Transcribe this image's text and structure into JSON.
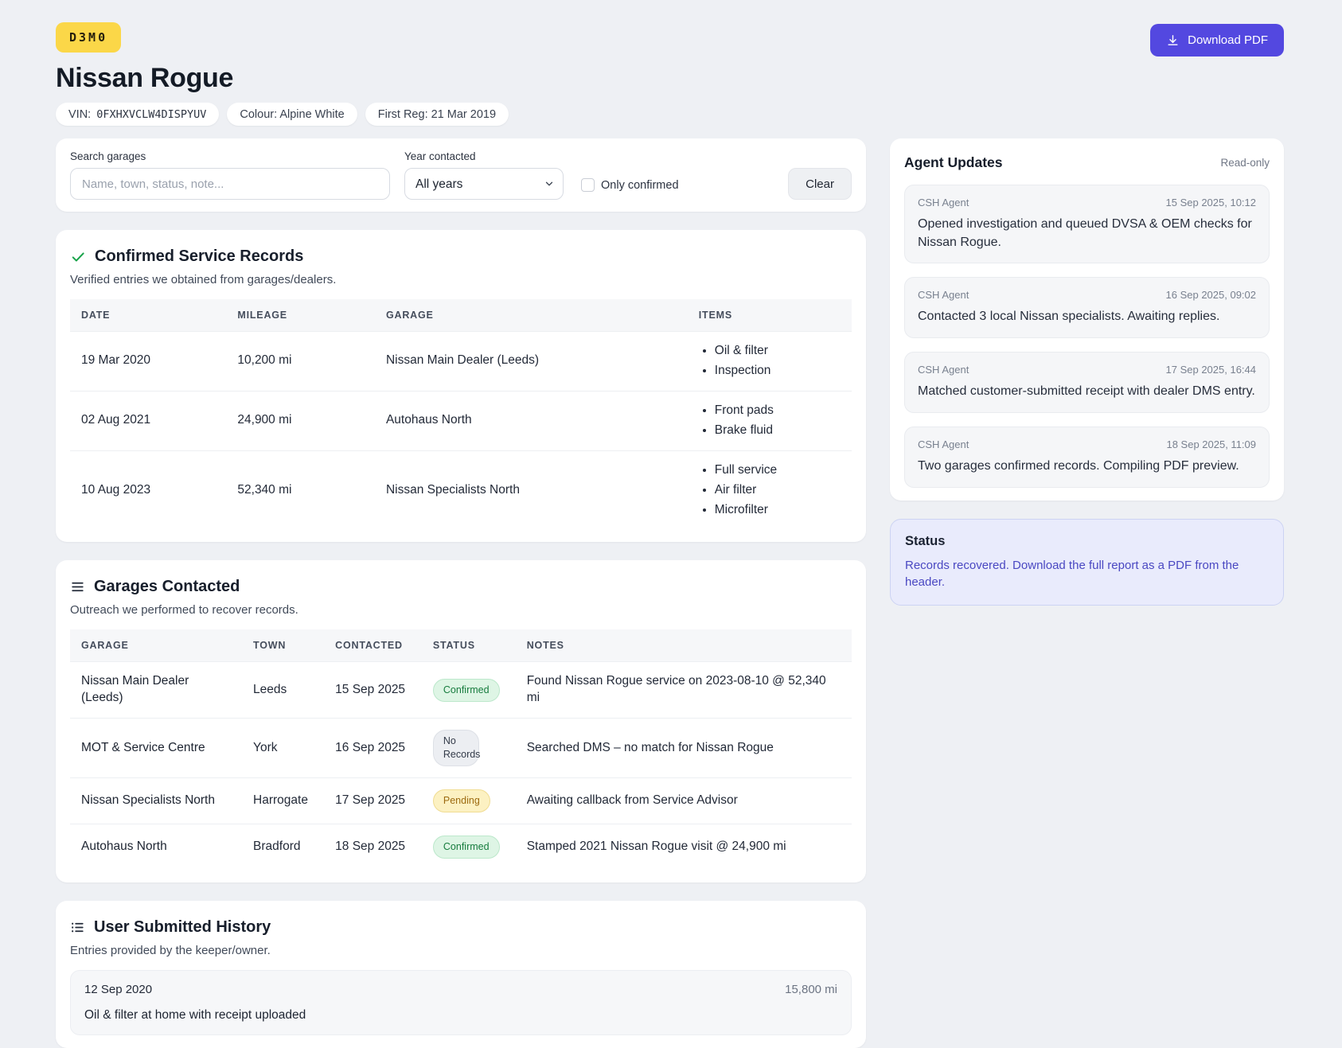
{
  "header": {
    "badge": "D3M0",
    "title": "Nissan Rogue",
    "chips": [
      {
        "label": "VIN:",
        "value": "0FXHXVCLW4DISPYUV",
        "value_mono": true
      },
      {
        "label": "Colour: Alpine White"
      },
      {
        "label": "First Reg: 21 Mar 2019"
      }
    ],
    "download_label": "Download PDF"
  },
  "filters": {
    "search_label": "Search garages",
    "search_placeholder": "Name, town, status, note...",
    "year_label": "Year contacted",
    "year_value": "All years",
    "only_confirmed_label": "Only confirmed",
    "clear_label": "Clear"
  },
  "confirmed_records": {
    "title": "Confirmed Service Records",
    "subtitle": "Verified entries we obtained from garages/dealers.",
    "columns": [
      "DATE",
      "MILEAGE",
      "GARAGE",
      "ITEMS"
    ],
    "rows": [
      {
        "date": "19 Mar 2020",
        "mileage": "10,200 mi",
        "garage": "Nissan Main Dealer (Leeds)",
        "items": [
          "Oil & filter",
          "Inspection"
        ]
      },
      {
        "date": "02 Aug 2021",
        "mileage": "24,900 mi",
        "garage": "Autohaus North",
        "items": [
          "Front pads",
          "Brake fluid"
        ]
      },
      {
        "date": "10 Aug 2023",
        "mileage": "52,340 mi",
        "garage": "Nissan Specialists North",
        "items": [
          "Full service",
          "Air filter",
          "Microfilter"
        ]
      }
    ]
  },
  "garages_contacted": {
    "title": "Garages Contacted",
    "subtitle": "Outreach we performed to recover records.",
    "columns": [
      "GARAGE",
      "TOWN",
      "CONTACTED",
      "STATUS",
      "NOTES"
    ],
    "rows": [
      {
        "garage": "Nissan Main Dealer (Leeds)",
        "town": "Leeds",
        "contacted": "15 Sep 2025",
        "status": "Confirmed",
        "status_type": "confirmed",
        "notes": "Found Nissan Rogue service on 2023-08-10 @ 52,340 mi"
      },
      {
        "garage": "MOT & Service Centre",
        "town": "York",
        "contacted": "16 Sep 2025",
        "status": "No Records",
        "status_type": "none",
        "notes": "Searched DMS – no match for Nissan Rogue"
      },
      {
        "garage": "Nissan Specialists North",
        "town": "Harrogate",
        "contacted": "17 Sep 2025",
        "status": "Pending",
        "status_type": "pending",
        "notes": "Awaiting callback from Service Advisor"
      },
      {
        "garage": "Autohaus North",
        "town": "Bradford",
        "contacted": "18 Sep 2025",
        "status": "Confirmed",
        "status_type": "confirmed",
        "notes": "Stamped 2021 Nissan Rogue visit @ 24,900 mi"
      }
    ]
  },
  "user_history": {
    "title": "User Submitted History",
    "subtitle": "Entries provided by the keeper/owner.",
    "entries": [
      {
        "date": "12 Sep 2020",
        "mileage": "15,800 mi",
        "note": "Oil & filter at home with receipt uploaded"
      }
    ]
  },
  "agent_updates": {
    "title": "Agent Updates",
    "readonly_label": "Read-only",
    "updates": [
      {
        "agent": "CSH Agent",
        "time": "15 Sep 2025, 10:12",
        "text": "Opened investigation and queued DVSA & OEM checks for Nissan Rogue."
      },
      {
        "agent": "CSH Agent",
        "time": "16 Sep 2025, 09:02",
        "text": "Contacted 3 local Nissan specialists. Awaiting replies."
      },
      {
        "agent": "CSH Agent",
        "time": "17 Sep 2025, 16:44",
        "text": "Matched customer-submitted receipt with dealer DMS entry."
      },
      {
        "agent": "CSH Agent",
        "time": "18 Sep 2025, 11:09",
        "text": "Two garages confirmed records. Compiling PDF preview."
      }
    ]
  },
  "status_panel": {
    "title": "Status",
    "text": "Records recovered. Download the full report as a PDF from the header."
  },
  "colors": {
    "accent": "#5348e0",
    "badge_bg": "#fbd748",
    "confirmed_bg": "#def5e5",
    "confirmed_text": "#177c3e",
    "pending_bg": "#fcf1c2",
    "pending_text": "#9c6a10",
    "none_bg": "#eceef2",
    "none_text": "#333b49",
    "status_bg": "#e9ebfc",
    "status_text": "#4a48c2",
    "check_green": "#18a34a"
  }
}
